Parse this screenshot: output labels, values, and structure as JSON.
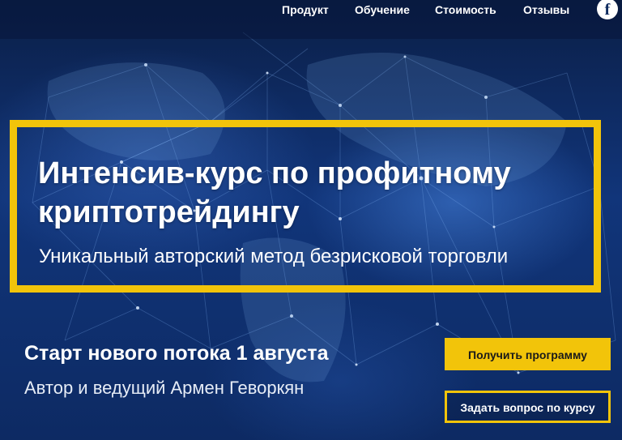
{
  "nav": {
    "items": [
      "Продукт",
      "Обучение",
      "Стоимость",
      "Отзывы"
    ],
    "social_icon": "facebook-icon",
    "social_glyph": "f"
  },
  "hero": {
    "title": "Интенсив-курс по профитному криптотрейдингу",
    "subtitle": "Уникальный авторский метод безрисковой торговли",
    "start": "Старт нового потока 1 августа",
    "author": "Автор и ведущий Армен Геворкян",
    "get_program_label": "Получить программу",
    "ask_question_label": "Задать вопрос по курсу"
  },
  "colors": {
    "accent": "#f2c40a",
    "background": "#0d2a5e",
    "text": "#ffffff"
  }
}
